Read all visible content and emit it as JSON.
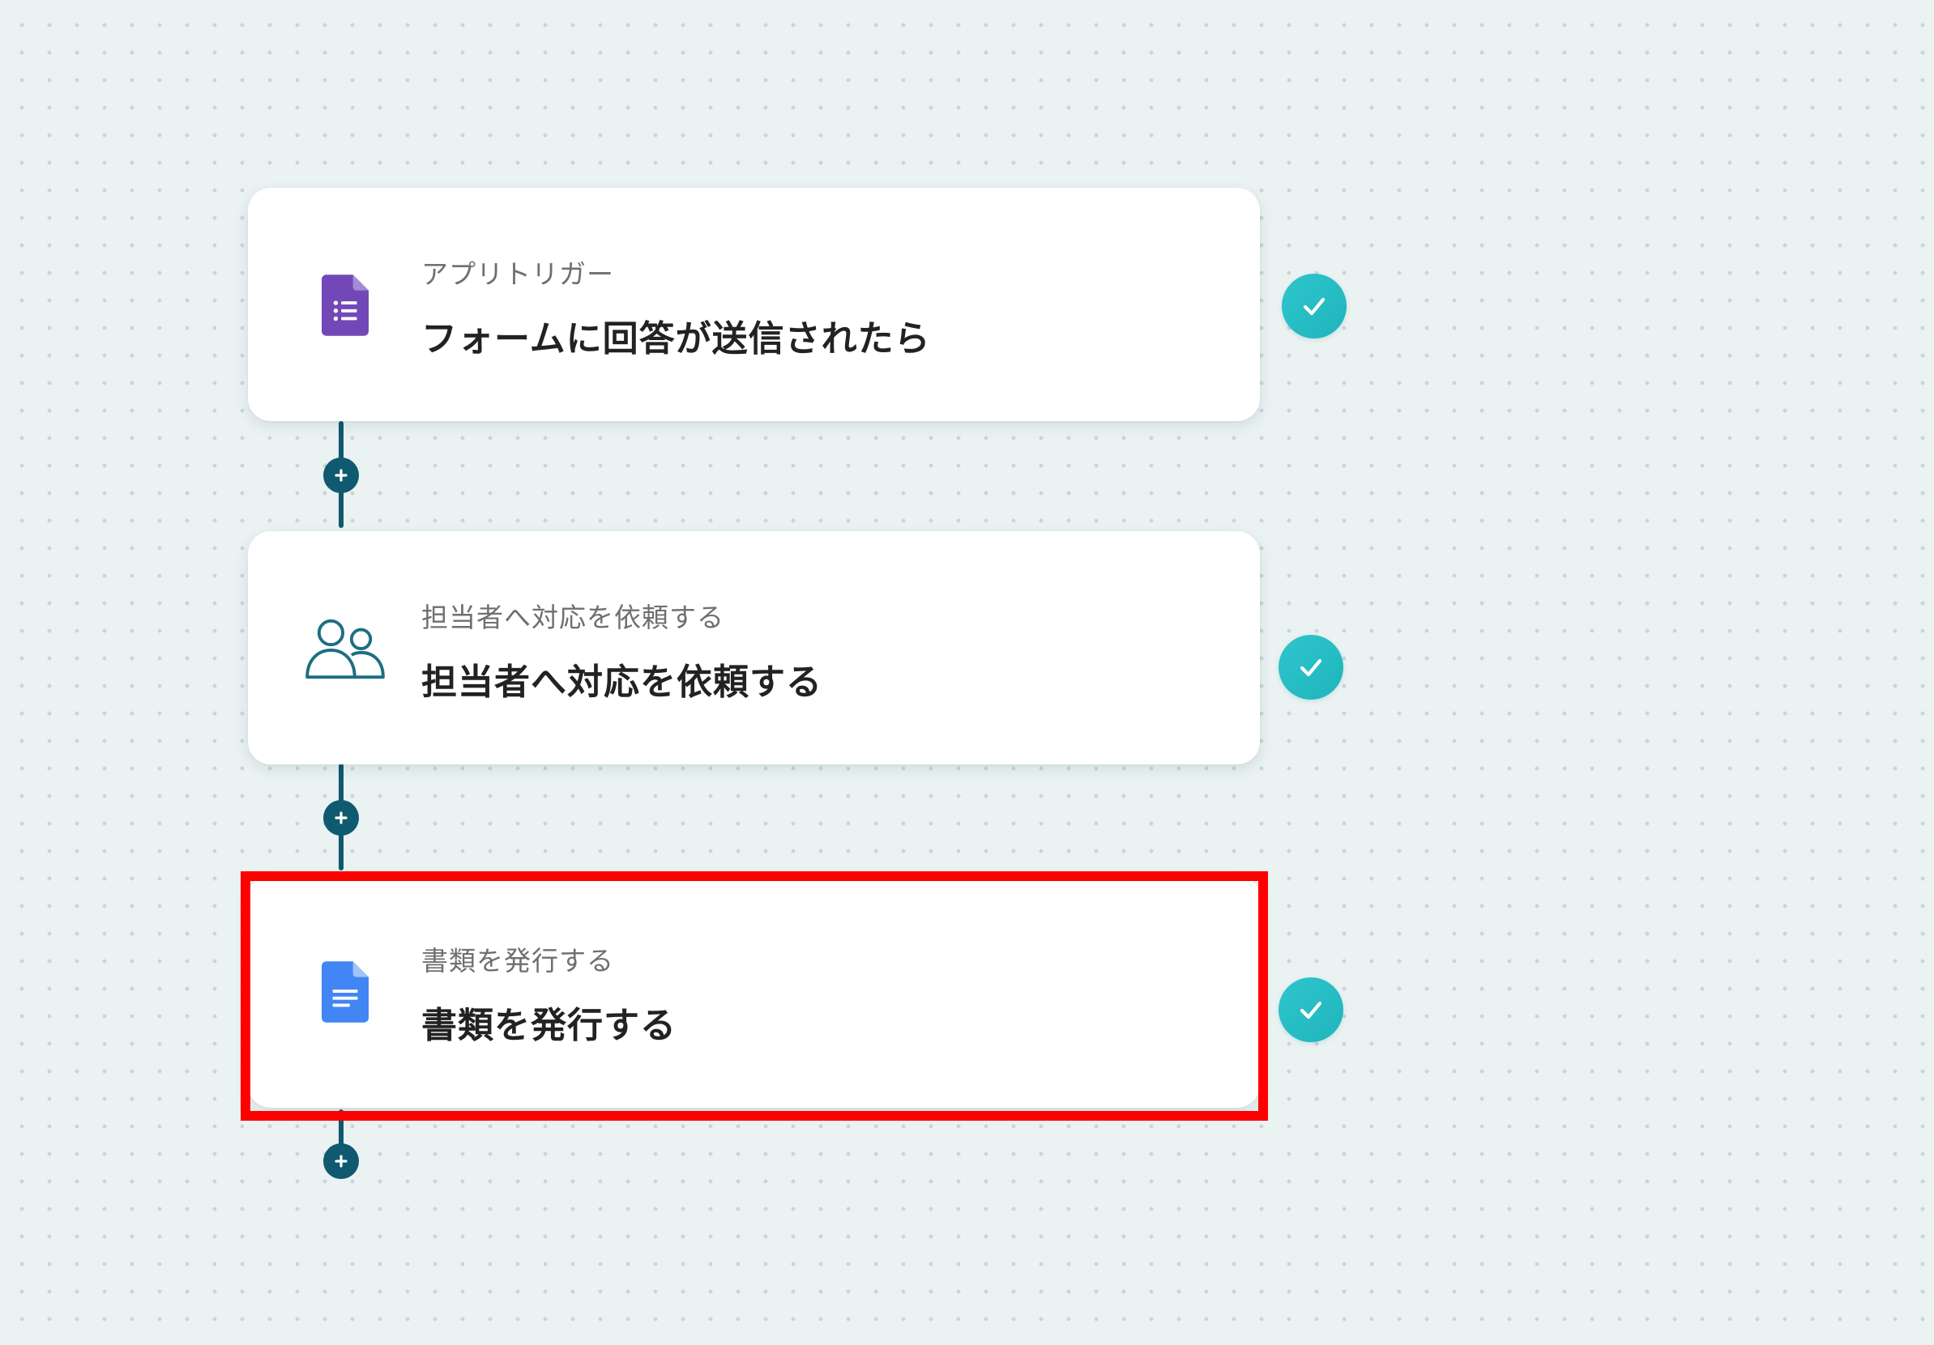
{
  "workflow": {
    "steps": [
      {
        "subtitle": "アプリトリガー",
        "title": "フォームに回答が送信されたら",
        "icon": "google-forms-icon",
        "status": "completed"
      },
      {
        "subtitle": "担当者へ対応を依頼する",
        "title": "担当者へ対応を依頼する",
        "icon": "users-icon",
        "status": "completed"
      },
      {
        "subtitle": "書類を発行する",
        "title": "書類を発行する",
        "icon": "google-docs-icon",
        "status": "completed",
        "highlighted": true
      }
    ]
  },
  "colors": {
    "background": "#eaf2f2",
    "connector": "#0f5a70",
    "check": "#2ec5cc",
    "highlight": "#ff0000",
    "forms_purple": "#7248b9",
    "docs_blue": "#4285f4",
    "users_teal": "#1d6e83"
  }
}
